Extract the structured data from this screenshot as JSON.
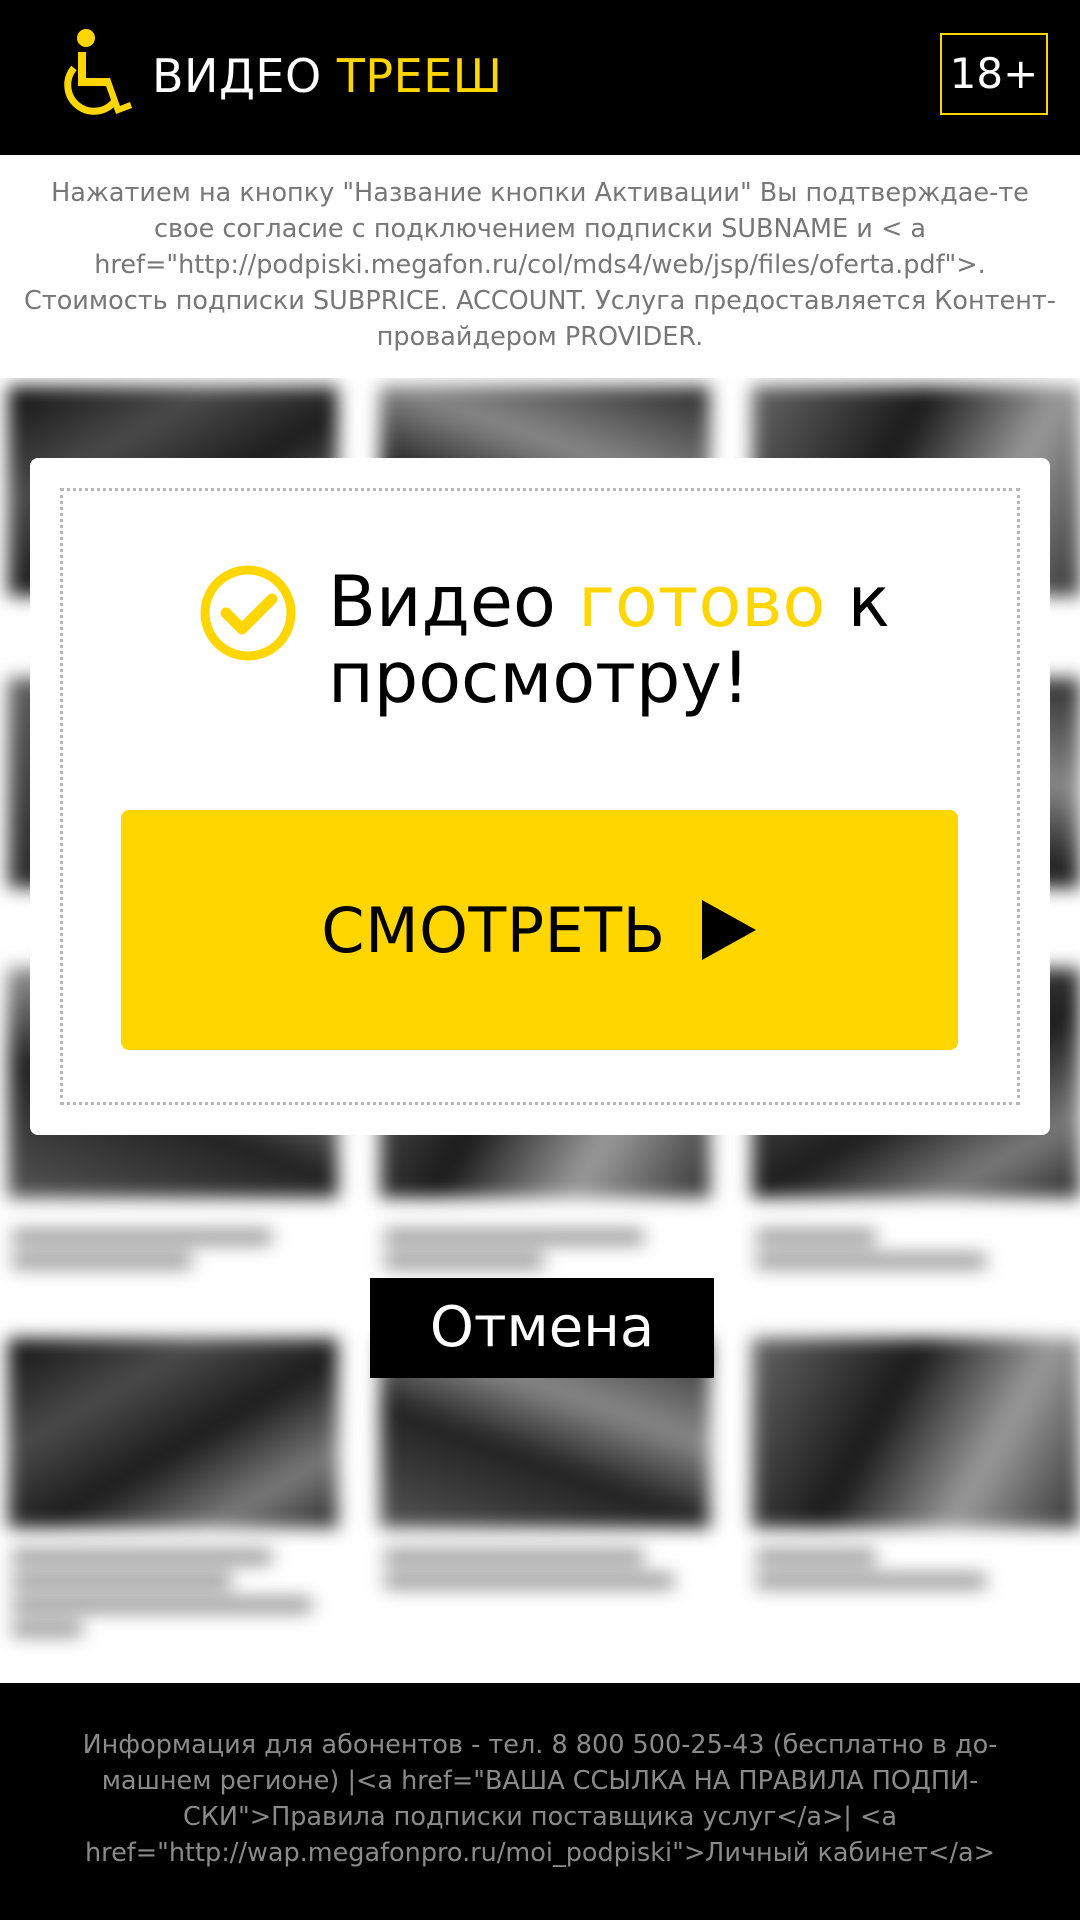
{
  "header": {
    "logo_word1": "ВИДЕО",
    "logo_word2": "ТРЕЕШ",
    "age_badge": "18+"
  },
  "disclaimer": {
    "text": "Нажатием на кнопку \"Название кнопки Активации\" Вы подтверждае-те свое согласие с подключением подписки SUBNAME и < a href=\"http://podpiski.megafon.ru/col/mds4/web/jsp/files/oferta.pdf\">. Стоимость подписки SUBPRICE. ACCOUNT. Услуга предоставляется Контент-провайдером PROVIDER."
  },
  "modal": {
    "headline_part1": "Видео ",
    "headline_accent": "готово",
    "headline_part2": " к просмотру!",
    "watch_button": "СМОТРЕТЬ"
  },
  "cancel_button": "Отмена",
  "footer": {
    "text": "Информация для абонентов - тел. 8 800 500-25-43 (бесплатно в до-машнем регионе) |<a href=\"ВАША ССЫЛКА НА ПРАВИЛА ПОДПИ-СКИ\">Правила подписки поставщика услуг</a>| <a href=\"http://wap.megafonpro.ru/moi_podpiski\">Личный кабинет</a>"
  },
  "icons": {
    "logo": "wheelchair-icon",
    "check": "check-circle-icon",
    "play": "play-triangle-icon"
  },
  "colors": {
    "accent": "#ffd600",
    "header_bg": "#000000",
    "disclaimer_text": "#777777"
  }
}
